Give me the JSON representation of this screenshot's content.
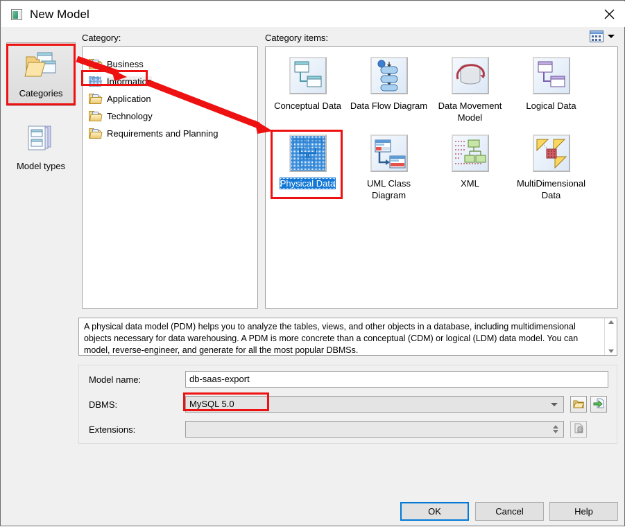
{
  "window": {
    "title": "New Model",
    "icon": "model-window-icon",
    "close_icon": "close-icon"
  },
  "header": {
    "category_label": "Category:",
    "category_items_label": "Category items:",
    "view_mode_icon": "details-view-icon",
    "view_mode_chevron": "chevron-down-icon"
  },
  "sidebar": {
    "items": [
      {
        "label": "Categories",
        "icon": "folder-pages-icon",
        "selected": true
      },
      {
        "label": "Model types",
        "icon": "stacked-pages-icon",
        "selected": false
      }
    ]
  },
  "category_list": {
    "items": [
      {
        "label": "Business",
        "icon": "folder-icon",
        "selected": false
      },
      {
        "label": "Information",
        "icon": "folder-icon",
        "selected": true
      },
      {
        "label": "Application",
        "icon": "folder-icon",
        "selected": false
      },
      {
        "label": "Technology",
        "icon": "folder-icon",
        "selected": false
      },
      {
        "label": "Requirements and Planning",
        "icon": "folder-icon",
        "selected": false
      }
    ]
  },
  "category_items": {
    "items": [
      {
        "label": "Conceptual Data",
        "icon": "conceptual-data-icon",
        "selected": false
      },
      {
        "label": "Data Flow Diagram",
        "icon": "data-flow-diagram-icon",
        "selected": false
      },
      {
        "label": "Data Movement Model",
        "icon": "data-movement-model-icon",
        "selected": false
      },
      {
        "label": "Logical Data",
        "icon": "logical-data-icon",
        "selected": false
      },
      {
        "label": "Physical Data",
        "icon": "physical-data-icon",
        "selected": true
      },
      {
        "label": "UML Class Diagram",
        "icon": "uml-class-diagram-icon",
        "selected": false
      },
      {
        "label": "XML",
        "icon": "xml-icon",
        "selected": false
      },
      {
        "label": "MultiDimensional Data",
        "icon": "multidimensional-data-icon",
        "selected": false
      }
    ]
  },
  "description": {
    "text": "A physical data model (PDM) helps you to analyze the tables, views, and other objects in a database, including multidimensional objects necessary for data warehousing. A PDM is more concrete than a conceptual (CDM) or logical (LDM) data model. You can model, reverse-engineer, and generate for all the most popular DBMSs.",
    "scroll_up_icon": "chevron-up-icon",
    "scroll_down_icon": "chevron-down-icon"
  },
  "form": {
    "model_name_label": "Model name:",
    "model_name_value": "db-saas-export",
    "model_name_placeholder": "",
    "dbms_label": "DBMS:",
    "dbms_value": "MySQL 5.0",
    "dbms_chevron": "chevron-down-icon",
    "dbms_browse_icon": "folder-open-icon",
    "dbms_new_icon": "page-add-icon",
    "extensions_label": "Extensions:",
    "extensions_value": "",
    "extensions_placeholder": "",
    "extensions_spinner": "spinner-updown-icon",
    "extensions_browse_icon": "page-icon-disabled"
  },
  "footer": {
    "ok_label": "OK",
    "cancel_label": "Cancel",
    "help_label": "Help"
  },
  "annotations": {
    "accent_color": "#ee1111",
    "boxes": [
      {
        "name": "categories-highlight"
      },
      {
        "name": "information-highlight"
      },
      {
        "name": "physical-data-highlight"
      },
      {
        "name": "dbms-value-highlight"
      }
    ],
    "arrows": [
      {
        "name": "arrow-categories-to-information"
      },
      {
        "name": "arrow-information-to-physical-data"
      }
    ]
  }
}
